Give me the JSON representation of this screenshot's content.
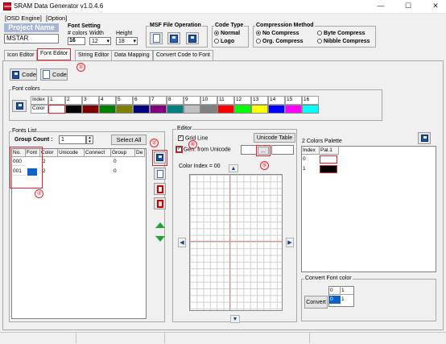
{
  "window": {
    "title": "SRAM Data Generator v1.0.4.6",
    "app_icon": "SRAM",
    "minimize": "—",
    "maximize": "☐",
    "close": "✕"
  },
  "menu": [
    "[OSD Engine]",
    "[Option]"
  ],
  "project": {
    "label": "Project Name",
    "value": "MSTAR"
  },
  "font_setting": {
    "title": "Font Setting",
    "colors_label": "# colors",
    "width_label": "Width",
    "height_label": "Height",
    "colors_value": "16",
    "width_value": "12",
    "height_value": "18"
  },
  "msf": {
    "title": "MSF File Operation"
  },
  "code_type": {
    "title": "Code Type",
    "options": [
      "Normal",
      "Logo"
    ],
    "selected": "Normal"
  },
  "compression": {
    "title": "Compression Method",
    "options": [
      "No Compress",
      "Byte Compress",
      "Org. Compress",
      "Nibble Compress"
    ],
    "selected": "No Compress"
  },
  "tabs": [
    "Icon Editor",
    "Font Editor",
    "String Editor",
    "Data Mapping",
    "Convert Code to Font"
  ],
  "active_tab": "Font Editor",
  "toolbar": {
    "code1": "Code",
    "code2": "Code"
  },
  "font_colors": {
    "title": "Font colors",
    "index_label": "Index",
    "color_label": "Color",
    "indexes": [
      "1",
      "2",
      "3",
      "4",
      "5",
      "6",
      "7",
      "8",
      "9",
      "10",
      "11",
      "12",
      "13",
      "14",
      "15",
      "16"
    ],
    "colors": [
      "#ffffff",
      "#000000",
      "#800000",
      "#008000",
      "#808000",
      "#000080",
      "#800080",
      "#008080",
      "#c0c0c0",
      "#808080",
      "#ff0000",
      "#00ff00",
      "#ffff00",
      "#0000ff",
      "#ff00ff",
      "#00ffff"
    ]
  },
  "fonts_list": {
    "title": "Fonts List",
    "group_count_label": "Group Count :",
    "group_count_value": "1",
    "select_all": "Select All",
    "columns": [
      "No.",
      "Font",
      "Color",
      "Unicode",
      "Connect",
      "Group",
      "De"
    ],
    "rows": [
      {
        "no": "000",
        "color": "2",
        "group": "0"
      },
      {
        "no": "001",
        "color": "2",
        "group": "0"
      }
    ]
  },
  "editor": {
    "title": "Editor",
    "grid_line": "Grid Line",
    "unicode_table": "Unicode Table",
    "gen_from_unicode": "Gen. from Unicode",
    "browse": "...",
    "color_index": "Color Index = 00"
  },
  "palette": {
    "title": "2 Colors Palette",
    "col_index": "Index",
    "col_pal": "Pal.1",
    "rows": [
      {
        "index": "0",
        "color": "#ffffff"
      },
      {
        "index": "1",
        "color": "#000000"
      }
    ]
  },
  "convert": {
    "title": "Convert Font color",
    "button": "Convert",
    "from": [
      "0",
      "0"
    ],
    "to": [
      "1",
      "1"
    ]
  },
  "annotations": [
    "①",
    "②",
    "③",
    "④",
    "⑤"
  ]
}
